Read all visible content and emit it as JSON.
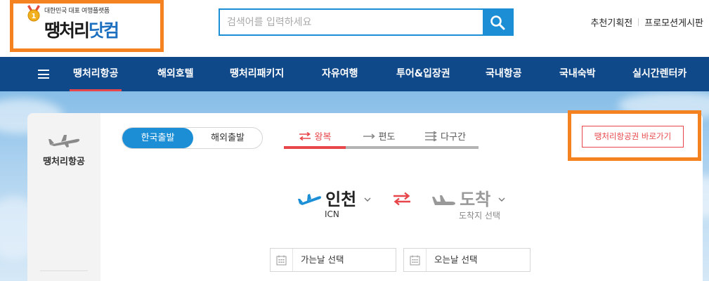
{
  "header": {
    "logo": {
      "tagline": "대한민국 대표 여행플랫폼",
      "brand_main": "땡처리",
      "brand_accent": "닷컴",
      "medal_number": "1"
    },
    "search": {
      "placeholder": "검색어를 입력하세요",
      "value": ""
    },
    "links": [
      "추천기획전",
      "프로모션게시판"
    ]
  },
  "nav": {
    "items": [
      {
        "label": "땡처리항공",
        "active": true
      },
      {
        "label": "해외호텔"
      },
      {
        "label": "땡처리패키지"
      },
      {
        "label": "자유여행"
      },
      {
        "label": "투어&입장권"
      },
      {
        "label": "국내항공"
      },
      {
        "label": "국내숙박"
      },
      {
        "label": "실시간렌터카"
      }
    ]
  },
  "side": {
    "label": "땡처리항공",
    "icon": "airplane-icon"
  },
  "booking": {
    "departure_toggle": {
      "selected": "한국출발",
      "other": "해외출발"
    },
    "trip_types": [
      {
        "label": "왕복",
        "icon": "round-trip-icon",
        "active": true
      },
      {
        "label": "편도",
        "icon": "one-way-icon"
      },
      {
        "label": "다구간",
        "icon": "multi-city-icon"
      }
    ],
    "shortcut_button": "땡처리항공권 바로가기",
    "origin": {
      "city": "인천",
      "code": "ICN"
    },
    "destination": {
      "city": "도착",
      "hint": "도착지 선택"
    },
    "dates": {
      "depart_label": "가는날 선택",
      "return_label": "오는날 선택"
    }
  },
  "colors": {
    "nav_bg": "#10498a",
    "accent_blue": "#1b8ed6",
    "accent_red": "#e7474b",
    "highlight_orange": "#f58220"
  }
}
